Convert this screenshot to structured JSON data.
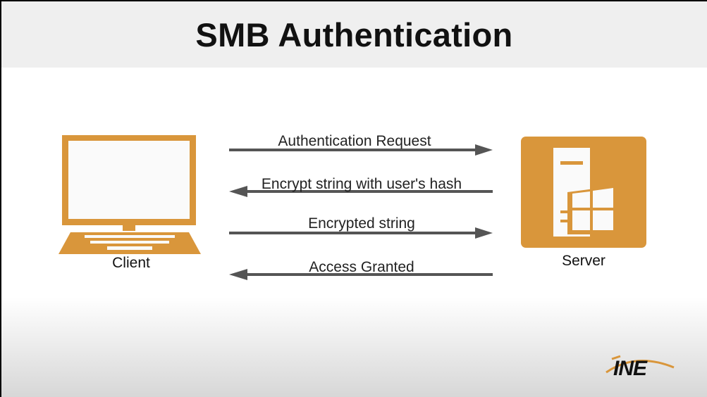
{
  "title": "SMB Authentication",
  "nodes": {
    "client": "Client",
    "server": "Server"
  },
  "messages": [
    {
      "label": "Authentication Request",
      "direction": "client-to-server"
    },
    {
      "label": "Encrypt string with user's hash",
      "direction": "server-to-client"
    },
    {
      "label": "Encrypted string",
      "direction": "client-to-server"
    },
    {
      "label": "Access Granted",
      "direction": "server-to-client"
    }
  ],
  "logo": {
    "text": "INE"
  },
  "colors": {
    "icon": "#d9963b",
    "arrow": "#555555",
    "logo_swoosh": "#d9963b"
  },
  "icons": {
    "client": "laptop-icon",
    "server": "windows-server-icon"
  }
}
